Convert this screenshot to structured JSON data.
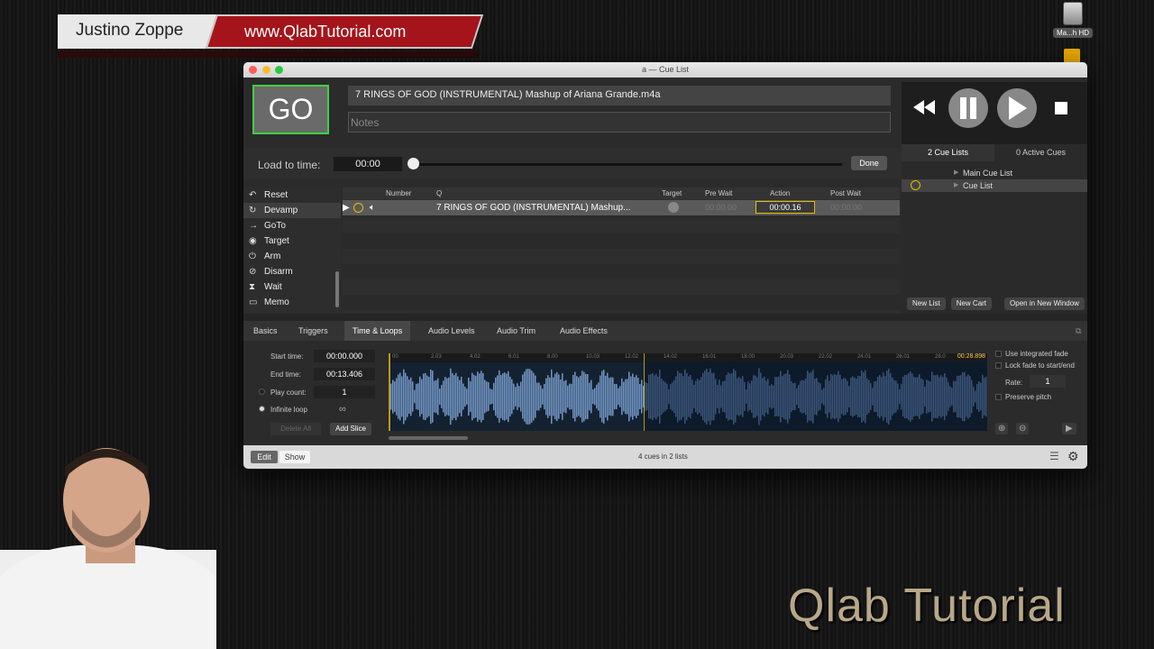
{
  "banner": {
    "name": "Justino Zoppe",
    "site": "www.QlabTutorial.com"
  },
  "desktop": {
    "drive_label": "Ma...h HD"
  },
  "window": {
    "title": "a — Cue List"
  },
  "go_label": "GO",
  "cue": {
    "name": "7 RINGS OF GOD (INSTRUMENTAL)  Mashup of Ariana Grande.m4a",
    "notes_placeholder": "Notes"
  },
  "load": {
    "label": "Load to time:",
    "time": "00:00",
    "done": "Done"
  },
  "sidebar": {
    "tabs": [
      "2 Cue Lists",
      "0 Active Cues"
    ],
    "lists": [
      "Main Cue List",
      "Cue List"
    ],
    "buttons": [
      "New List",
      "New Cart",
      "Open in New Window"
    ]
  },
  "actions": [
    "Reset",
    "Devamp",
    "GoTo",
    "Target",
    "Arm",
    "Disarm",
    "Wait",
    "Memo"
  ],
  "cuetable": {
    "headers": {
      "number": "Number",
      "q": "Q",
      "target": "Target",
      "prewait": "Pre Wait",
      "action": "Action",
      "postwait": "Post Wait"
    },
    "row": {
      "name": "7 RINGS OF GOD (INSTRUMENTAL)  Mashup...",
      "prewait": "00:00.00",
      "action": "00:00.16",
      "postwait": "00:00.00"
    }
  },
  "inspector": {
    "tabs": [
      "Basics",
      "Triggers",
      "Time & Loops",
      "Audio Levels",
      "Audio Trim",
      "Audio Effects"
    ],
    "start_label": "Start time:",
    "start_value": "00:00.000",
    "end_label": "End time:",
    "end_value": "00:13.406",
    "playcount_label": "Play count:",
    "playcount_value": "1",
    "infinite_label": "Infinite loop",
    "infinite_value": "∞",
    "delete_all": "Delete All",
    "add_slice": "Add Slice",
    "ruler": [
      "00",
      "2.03",
      "4.02",
      "6.01",
      "8.00",
      "10.03",
      "12.02",
      "14.02",
      "16.01",
      "18.00",
      "20.03",
      "22.02",
      "24.01",
      "26.01",
      "28.0"
    ],
    "time_badge": "00:28.898",
    "opts": [
      "Use integrated fade",
      "Lock fade to start/end"
    ],
    "rate_label": "Rate:",
    "rate_value": "1",
    "preserve_pitch": "Preserve pitch"
  },
  "bottombar": {
    "edit": "Edit",
    "show": "Show",
    "status": "4 cues in 2 lists"
  },
  "watermark": "Qlab Tutorial",
  "colors": {
    "go_border": "#3ed23e",
    "selection_yellow": "#e7c000",
    "waveform": "#6e93c4"
  }
}
